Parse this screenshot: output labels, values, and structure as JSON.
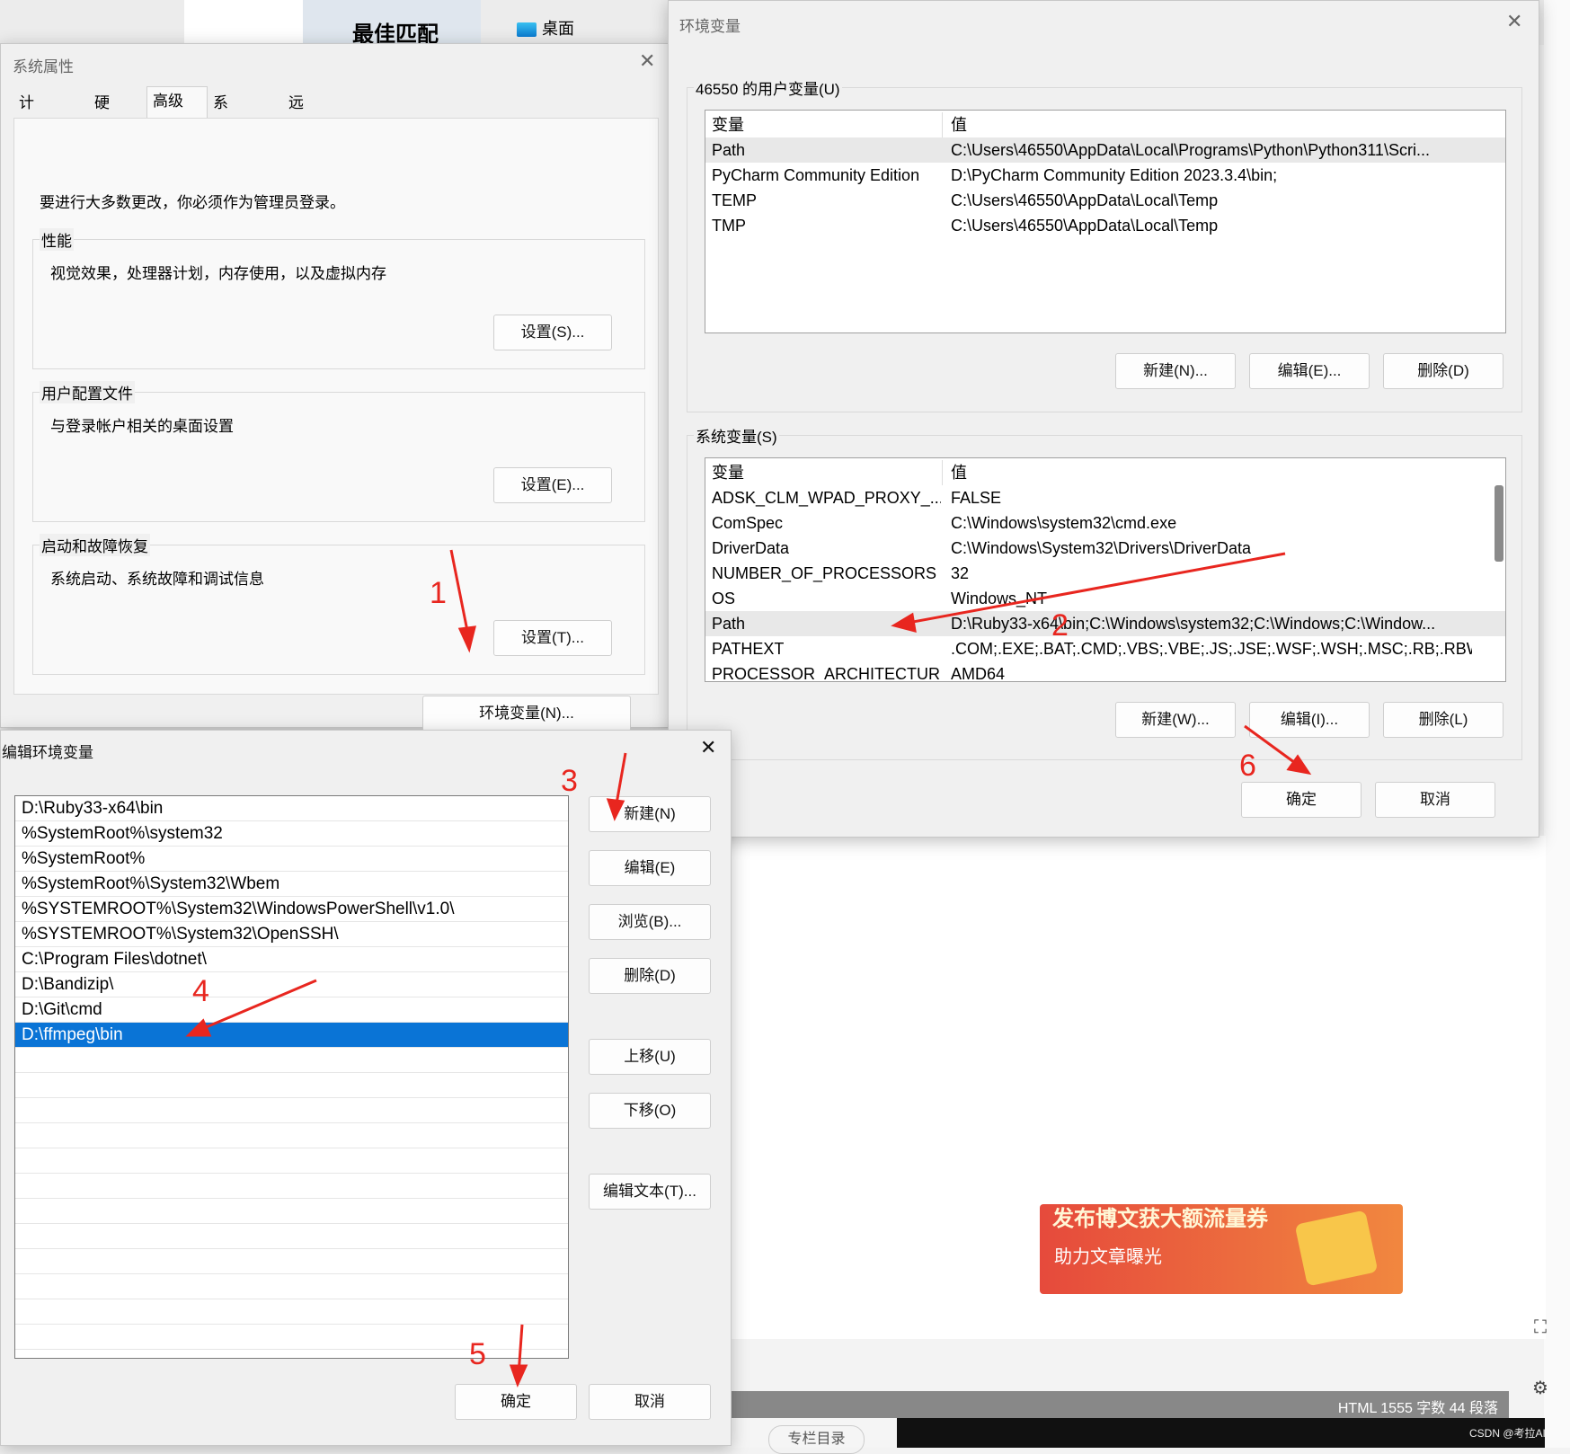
{
  "background": {
    "best_match": "最佳匹配",
    "desktop": "桌面",
    "banner_line1": "发布博文获大额流量券",
    "banner_line2": "助力文章曝光",
    "statusbar": "HTML  1555 字数  44 段落",
    "bottom_pill": "专栏目录",
    "watermark": "CSDN @考拉AI"
  },
  "sys_props": {
    "title": "系统属性",
    "tabs": [
      "计算机名",
      "硬件",
      "高级",
      "系统保护",
      "远程"
    ],
    "admin_note": "要进行大多数更改，你必须作为管理员登录。",
    "perf_label": "性能",
    "perf_desc": "视觉效果，处理器计划，内存使用，以及虚拟内存",
    "perf_btn": "设置(S)...",
    "profile_label": "用户配置文件",
    "profile_desc": "与登录帐户相关的桌面设置",
    "profile_btn": "设置(E)...",
    "startup_label": "启动和故障恢复",
    "startup_desc": "系统启动、系统故障和调试信息",
    "startup_btn": "设置(T)...",
    "env_btn": "环境变量(N)..."
  },
  "env_vars": {
    "title": "环境变量",
    "user_label": "46550 的用户变量(U)",
    "col_name": "变量",
    "col_value": "值",
    "user_rows": [
      {
        "name": "Path",
        "value": "C:\\Users\\46550\\AppData\\Local\\Programs\\Python\\Python311\\Scri..."
      },
      {
        "name": "PyCharm Community Edition",
        "value": "D:\\PyCharm Community Edition 2023.3.4\\bin;"
      },
      {
        "name": "TEMP",
        "value": "C:\\Users\\46550\\AppData\\Local\\Temp"
      },
      {
        "name": "TMP",
        "value": "C:\\Users\\46550\\AppData\\Local\\Temp"
      }
    ],
    "user_new": "新建(N)...",
    "user_edit": "编辑(E)...",
    "user_delete": "删除(D)",
    "sys_label": "系统变量(S)",
    "sys_rows": [
      {
        "name": "ADSK_CLM_WPAD_PROXY_...",
        "value": "FALSE"
      },
      {
        "name": "ComSpec",
        "value": "C:\\Windows\\system32\\cmd.exe"
      },
      {
        "name": "DriverData",
        "value": "C:\\Windows\\System32\\Drivers\\DriverData"
      },
      {
        "name": "NUMBER_OF_PROCESSORS",
        "value": "32"
      },
      {
        "name": "OS",
        "value": "Windows_NT"
      },
      {
        "name": "Path",
        "value": "D:\\Ruby33-x64\\bin;C:\\Windows\\system32;C:\\Windows;C:\\Window..."
      },
      {
        "name": "PATHEXT",
        "value": ".COM;.EXE;.BAT;.CMD;.VBS;.VBE;.JS;.JSE;.WSF;.WSH;.MSC;.RB;.RBW"
      },
      {
        "name": "PROCESSOR_ARCHITECTURE",
        "value": "AMD64"
      }
    ],
    "sys_new": "新建(W)...",
    "sys_edit": "编辑(I)...",
    "sys_delete": "删除(L)",
    "ok": "确定",
    "cancel": "取消"
  },
  "edit_env": {
    "title": "编辑环境变量",
    "entries": [
      "D:\\Ruby33-x64\\bin",
      "%SystemRoot%\\system32",
      "%SystemRoot%",
      "%SystemRoot%\\System32\\Wbem",
      "%SYSTEMROOT%\\System32\\WindowsPowerShell\\v1.0\\",
      "%SYSTEMROOT%\\System32\\OpenSSH\\",
      "C:\\Program Files\\dotnet\\",
      "D:\\Bandizip\\",
      "D:\\Git\\cmd",
      "D:\\ffmpeg\\bin"
    ],
    "selected_index": 9,
    "new": "新建(N)",
    "edit": "编辑(E)",
    "browse": "浏览(B)...",
    "delete": "删除(D)",
    "move_up": "上移(U)",
    "move_down": "下移(O)",
    "edit_text": "编辑文本(T)...",
    "ok": "确定",
    "cancel": "取消"
  },
  "annotations": [
    "1",
    "2",
    "3",
    "4",
    "5",
    "6"
  ],
  "colors": {
    "annotation": "#e8261f",
    "selection": "#0a74d6"
  }
}
